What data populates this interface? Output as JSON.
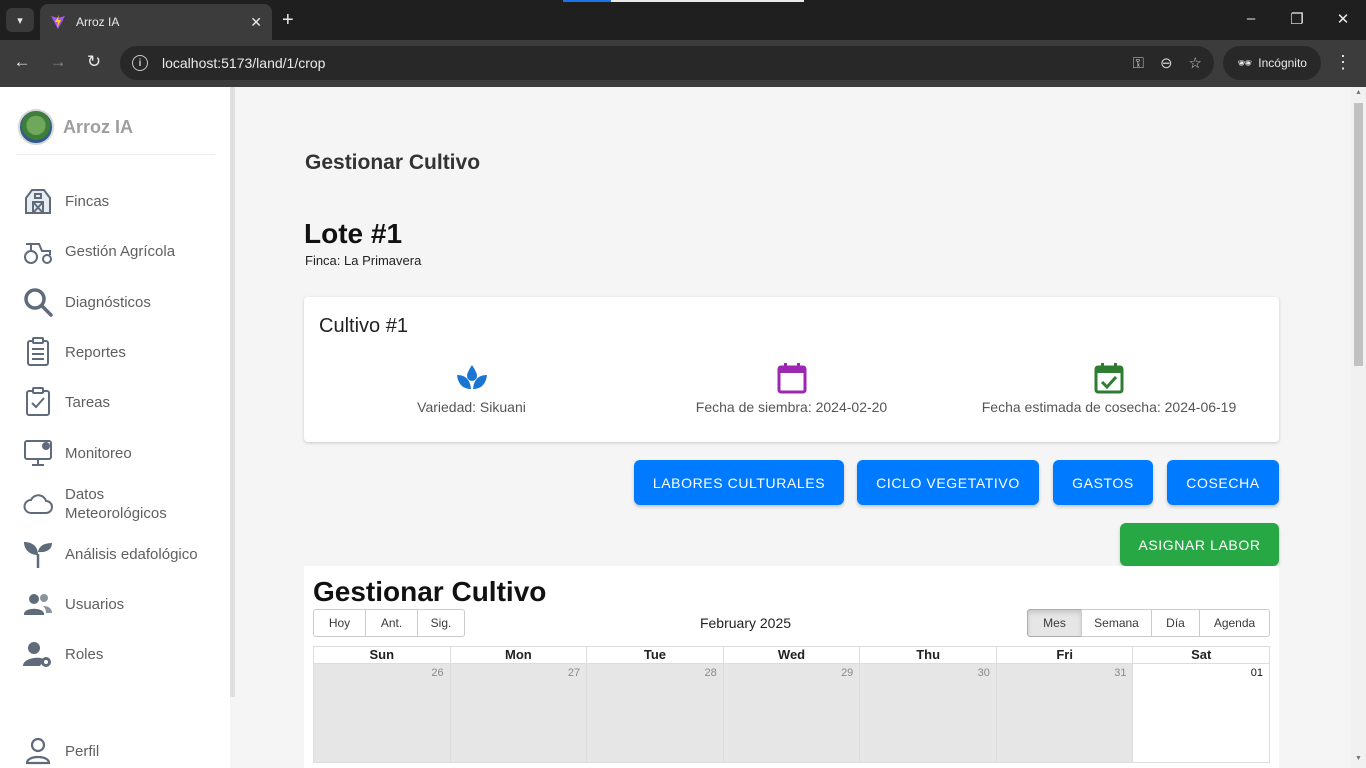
{
  "browser": {
    "tab_title": "Arroz IA",
    "url": "localhost:5173/land/1/crop",
    "incognito_label": "Incógnito"
  },
  "sidebar": {
    "app_name": "Arroz IA",
    "items": [
      {
        "label": "Fincas",
        "icon": "barn-icon"
      },
      {
        "label": "Gestión Agrícola",
        "icon": "tractor-icon"
      },
      {
        "label": "Diagnósticos",
        "icon": "search-icon"
      },
      {
        "label": "Reportes",
        "icon": "clipboard-icon"
      },
      {
        "label": "Tareas",
        "icon": "task-check-icon"
      },
      {
        "label": "Monitoreo",
        "icon": "monitor-icon"
      },
      {
        "label": "Datos Meteorológicos",
        "icon": "cloud-icon"
      },
      {
        "label": "Análisis edafológico",
        "icon": "sprout-icon"
      },
      {
        "label": "Usuarios",
        "icon": "users-icon"
      },
      {
        "label": "Roles",
        "icon": "user-gear-icon"
      }
    ],
    "profile_label": "Perfil"
  },
  "main": {
    "page_title": "Gestionar Cultivo",
    "lote_title": "Lote #1",
    "finca_label": "Finca: La Primavera",
    "crop_card": {
      "title": "Cultivo #1",
      "variety": "Variedad: Sikuani",
      "sowing_date": "Fecha de siembra: 2024-02-20",
      "harvest_date": "Fecha estimada de cosecha: 2024-06-19",
      "colors": {
        "variety_icon": "#1976d2",
        "sowing_icon": "#9c27b0",
        "harvest_icon": "#2e7d32"
      }
    },
    "actions": {
      "labores": "LABORES CULTURALES",
      "ciclo": "CICLO VEGETATIVO",
      "gastos": "GASTOS",
      "cosecha": "COSECHA",
      "asignar": "ASIGNAR LABOR"
    },
    "calendar": {
      "title": "Gestionar Cultivo",
      "nav": {
        "today": "Hoy",
        "prev": "Ant.",
        "next": "Sig."
      },
      "label": "February 2025",
      "views": {
        "month": "Mes",
        "week": "Semana",
        "day": "Día",
        "agenda": "Agenda"
      },
      "active_view": "Mes",
      "weekdays": [
        "Sun",
        "Mon",
        "Tue",
        "Wed",
        "Thu",
        "Fri",
        "Sat"
      ],
      "first_week": [
        "26",
        "27",
        "28",
        "29",
        "30",
        "31",
        "01"
      ]
    }
  }
}
